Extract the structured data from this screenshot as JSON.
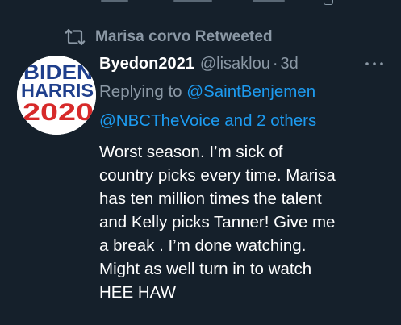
{
  "retweet": {
    "icon": "retweet-icon",
    "text": "Marisa corvo Retweeted"
  },
  "tweet": {
    "avatar": {
      "line1": "BIDEN",
      "line2": "HARRIS",
      "line3": "2020",
      "colors": {
        "blue": "#1f3f8c",
        "red": "#d72a2a",
        "white": "#ffffff"
      }
    },
    "display_name": "Byedon2021",
    "handle": "@lisaklou",
    "separator": "·",
    "time": "3d",
    "more_icon": "more-horizontal-icon",
    "reply_prefix": "Replying to ",
    "mention_1": "@SaintBenjemen",
    "mention_2": "@NBCTheVoice",
    "and_others": " and 2 others",
    "body_lines": [
      "Worst season. I’m sick of",
      "country picks every time. Marisa",
      "has ten million times the talent",
      "and Kelly picks Tanner! Give me",
      "a break . I’m done watching.",
      "Might as well turn in to watch",
      "HEE HAW"
    ]
  },
  "colors": {
    "background": "#15202b",
    "secondary_text": "#8b98a5",
    "primary_text": "#ffffff",
    "link": "#1d9bf0"
  }
}
